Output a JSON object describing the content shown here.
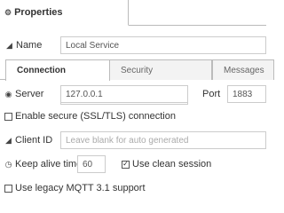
{
  "header": {
    "tab_label": "Properties",
    "tab_icon": "gear-icon"
  },
  "name": {
    "label": "Name",
    "value": "Local Service"
  },
  "tabs": [
    {
      "label": "Connection",
      "active": true
    },
    {
      "label": "Security",
      "active": false
    },
    {
      "label": "Messages",
      "active": false
    }
  ],
  "server": {
    "label": "Server",
    "value": "127.0.0.1"
  },
  "port": {
    "label": "Port",
    "value": "1883"
  },
  "tls": {
    "label": "Enable secure (SSL/TLS) connection",
    "checked": false
  },
  "client_id": {
    "label": "Client ID",
    "placeholder": "Leave blank for auto generated"
  },
  "keepalive": {
    "label": "Keep alive time (s)",
    "value": "60"
  },
  "clean_session": {
    "label": "Use clean session",
    "checked": true
  },
  "legacy": {
    "label": "Use legacy MQTT 3.1 support",
    "checked": false
  }
}
